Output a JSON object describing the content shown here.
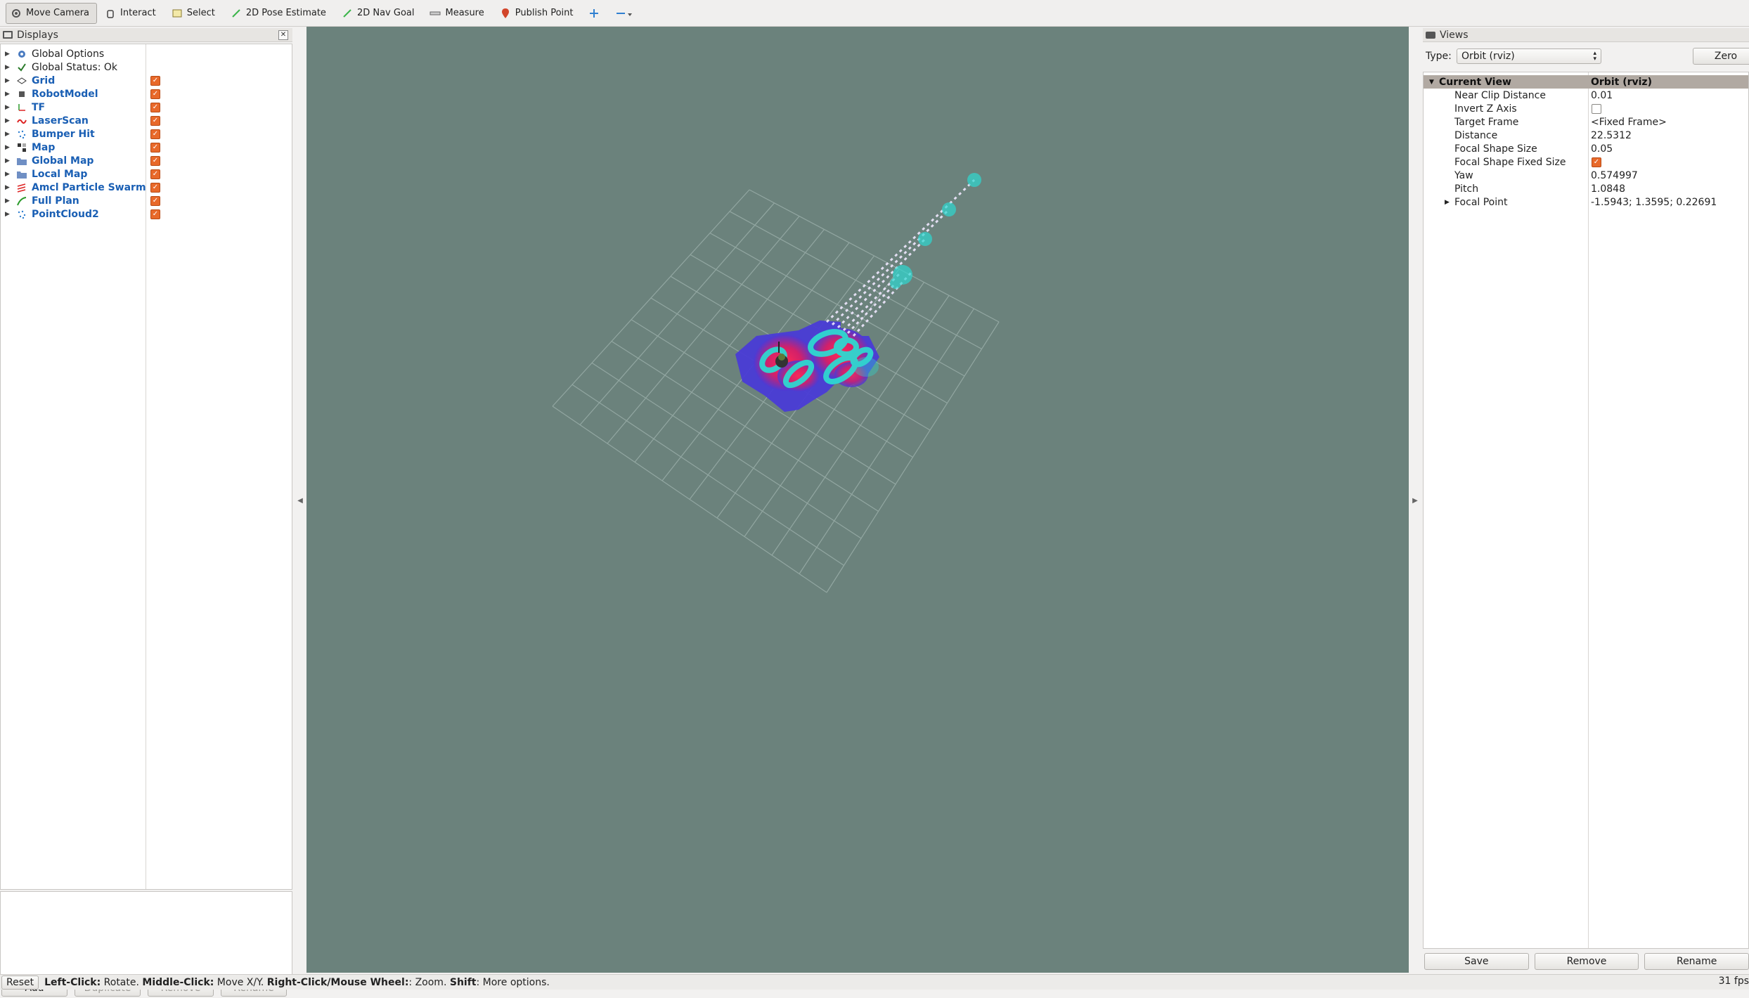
{
  "toolbar": {
    "tools": [
      {
        "label": "Move Camera",
        "icon": "move-camera-icon",
        "active": true
      },
      {
        "label": "Interact",
        "icon": "hand-icon"
      },
      {
        "label": "Select",
        "icon": "select-icon"
      },
      {
        "label": "2D Pose Estimate",
        "icon": "green-arrow-icon"
      },
      {
        "label": "2D Nav Goal",
        "icon": "green-arrow-icon"
      },
      {
        "label": "Measure",
        "icon": "ruler-icon"
      },
      {
        "label": "Publish Point",
        "icon": "pin-icon"
      }
    ]
  },
  "displays": {
    "title": "Displays",
    "items": [
      {
        "label": "Global Options",
        "icon": "gear-icon",
        "checked": null,
        "bold": false
      },
      {
        "label": "Global Status: Ok",
        "icon": "checkmark-icon",
        "checked": null,
        "bold": false
      },
      {
        "label": "Grid",
        "icon": "grid-icon",
        "checked": true,
        "bold": true
      },
      {
        "label": "RobotModel",
        "icon": "robot-icon",
        "checked": true,
        "bold": true
      },
      {
        "label": "TF",
        "icon": "tf-axes-icon",
        "checked": true,
        "bold": true
      },
      {
        "label": "LaserScan",
        "icon": "laser-scan-icon",
        "checked": true,
        "bold": true
      },
      {
        "label": "Bumper Hit",
        "icon": "point-cloud-icon",
        "checked": true,
        "bold": true
      },
      {
        "label": "Map",
        "icon": "map-icon",
        "checked": true,
        "bold": true
      },
      {
        "label": "Global Map",
        "icon": "folder-icon",
        "checked": true,
        "bold": true
      },
      {
        "label": "Local Map",
        "icon": "folder-icon",
        "checked": true,
        "bold": true
      },
      {
        "label": "Amcl Particle Swarm",
        "icon": "pose-array-icon",
        "checked": true,
        "bold": true
      },
      {
        "label": "Full Plan",
        "icon": "path-icon",
        "checked": true,
        "bold": true
      },
      {
        "label": "PointCloud2",
        "icon": "point-cloud-icon",
        "checked": true,
        "bold": true
      }
    ],
    "buttons": {
      "add": "Add",
      "duplicate": "Duplicate",
      "remove": "Remove",
      "rename": "Rename"
    }
  },
  "views": {
    "title": "Views",
    "type_label": "Type:",
    "type_value": "Orbit (rviz)",
    "zero": "Zero",
    "properties": [
      {
        "name": "Current View",
        "value": "Orbit (rviz)",
        "header": true
      },
      {
        "name": "Near Clip Distance",
        "value": "0.01"
      },
      {
        "name": "Invert Z Axis",
        "value": "",
        "checkbox": false
      },
      {
        "name": "Target Frame",
        "value": "<Fixed Frame>"
      },
      {
        "name": "Distance",
        "value": "22.5312"
      },
      {
        "name": "Focal Shape Size",
        "value": "0.05"
      },
      {
        "name": "Focal Shape Fixed Size",
        "value": "",
        "checkbox": true
      },
      {
        "name": "Yaw",
        "value": "0.574997"
      },
      {
        "name": "Pitch",
        "value": "1.0848"
      },
      {
        "name": "Focal Point",
        "value": "-1.5943; 1.3595; 0.22691",
        "expandable": true
      }
    ],
    "buttons": {
      "save": "Save",
      "remove": "Remove",
      "rename": "Rename"
    }
  },
  "status": {
    "reset": "Reset",
    "hint_parts": [
      {
        "text": "Left-Click:",
        "bold": true
      },
      {
        "text": " Rotate. ",
        "bold": false
      },
      {
        "text": "Middle-Click:",
        "bold": true
      },
      {
        "text": " Move X/Y. ",
        "bold": false
      },
      {
        "text": "Right-Click/Mouse Wheel:",
        "bold": true
      },
      {
        "text": ": Zoom. ",
        "bold": false
      },
      {
        "text": "Shift",
        "bold": true
      },
      {
        "text": ": More options.",
        "bold": false
      }
    ],
    "fps": "31 fps"
  },
  "colors": {
    "viewport_bg": "#6b827c",
    "grid_line": "#9fb3ae",
    "costmap_blue": "#4a3bd6",
    "costmap_red": "#e0204a",
    "inflation_cyan": "#2fd8d0",
    "checkbox_orange": "#e8692a",
    "link_blue": "#1a5fb4"
  }
}
